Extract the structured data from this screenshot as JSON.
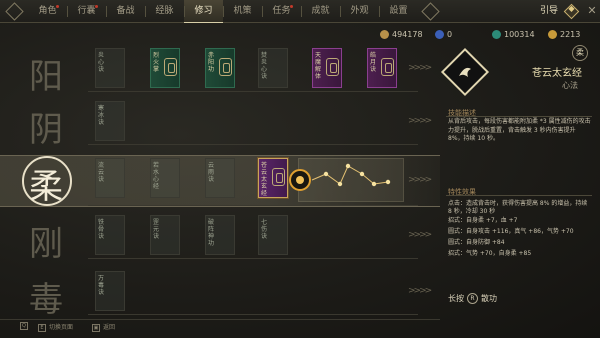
{
  "nav": {
    "tabs": [
      {
        "label": "角色",
        "active": false,
        "dot": true
      },
      {
        "label": "行囊",
        "active": false,
        "dot": true
      },
      {
        "label": "备战",
        "active": false,
        "dot": false
      },
      {
        "label": "经脉",
        "active": false,
        "dot": false
      },
      {
        "label": "修习",
        "active": true,
        "dot": false
      },
      {
        "label": "机策",
        "active": false,
        "dot": false
      },
      {
        "label": "任务",
        "active": false,
        "dot": true
      },
      {
        "label": "成就",
        "active": false,
        "dot": false
      },
      {
        "label": "外观",
        "active": false,
        "dot": false
      },
      {
        "label": "設置",
        "active": false,
        "dot": false
      }
    ],
    "guide_label": "引导",
    "guide_icon": "diamond-key-icon",
    "guide_glyph": "◆",
    "close_glyph": "✕"
  },
  "currencies": [
    {
      "icon": "copper-coin-icon",
      "color": "#b8914a",
      "value": "494178"
    },
    {
      "icon": "blue-gem-icon",
      "color": "#3b5fb8",
      "value": "0"
    },
    {
      "icon": "jade-icon",
      "color": "#2c8a78",
      "value": "100314"
    },
    {
      "icon": "gold-ingot-icon",
      "color": "#c79a3a",
      "value": "2213"
    }
  ],
  "rows": [
    {
      "char": "阳",
      "active": false,
      "books": [
        {
          "title": "炎心诀",
          "style": "empty"
        },
        {
          "title": "烈火掌",
          "style": "green",
          "emblem": true
        },
        {
          "title": "赤阳功",
          "style": "green",
          "emblem": true
        },
        {
          "title": "焚炎心诀",
          "style": "empty"
        },
        {
          "title": "天魔解体",
          "style": "purple",
          "emblem": true
        },
        {
          "title": "皓月诀",
          "style": "purple",
          "emblem": true
        }
      ]
    },
    {
      "char": "阴",
      "active": false,
      "books": [
        {
          "title": "寒冰诀",
          "style": "empty"
        }
      ]
    },
    {
      "char": "柔",
      "active": true,
      "books": [
        {
          "title": "流云诀",
          "style": "empty"
        },
        {
          "title": "若水心经",
          "style": "empty"
        },
        {
          "title": "云雨诀",
          "style": "empty"
        },
        {
          "title": "苍云太玄经",
          "style": "sel",
          "emblem": true
        }
      ]
    },
    {
      "char": "刚",
      "active": false,
      "books": [
        {
          "title": "铁骨诀",
          "style": "empty"
        },
        {
          "title": "罡元诀",
          "style": "empty"
        },
        {
          "title": "破阵神功",
          "style": "empty"
        },
        {
          "title": "七伤诀",
          "style": "empty"
        }
      ]
    },
    {
      "char": "毒",
      "active": false,
      "books": [
        {
          "title": "万毒诀",
          "style": "empty"
        }
      ]
    }
  ],
  "row_tag": "柔",
  "detail": {
    "emblem_icon": "swirl-technique-icon",
    "name": "苍云太玄经",
    "type": "心法",
    "effect_heading": "技能描述",
    "description": "从背后攻击，每段伤害都能附加柔 *3 属性减伤的攻击力提升，脱战后重置，背击触发 3 秒内伤害提升 8%，持续 10 秒。",
    "attr_heading": "特性效果",
    "attrs": [
      "点击：造成背击时，获得伤害提高 8% 的增益，持续 8 秒，冷却 30 秒",
      "招式：自身柔 +7，血 +7",
      "圆式：自身攻击 +116，真气 +86，气势 +70",
      "圆式：自身防御 +84",
      "招式：气势 +70，自身柔 +85"
    ],
    "hint_left": "长按",
    "hint_key": "R",
    "hint_right": "散功"
  },
  "bottom": {
    "items": [
      {
        "key": "Q",
        "label": ""
      },
      {
        "key": "E",
        "label": "切换页面"
      },
      {
        "key": "▣",
        "label": "返回"
      }
    ]
  },
  "colors": {
    "accent": "#e8dfbf",
    "selected_border": "#c7a55c",
    "active_tab_line": "#d8cfa8"
  }
}
